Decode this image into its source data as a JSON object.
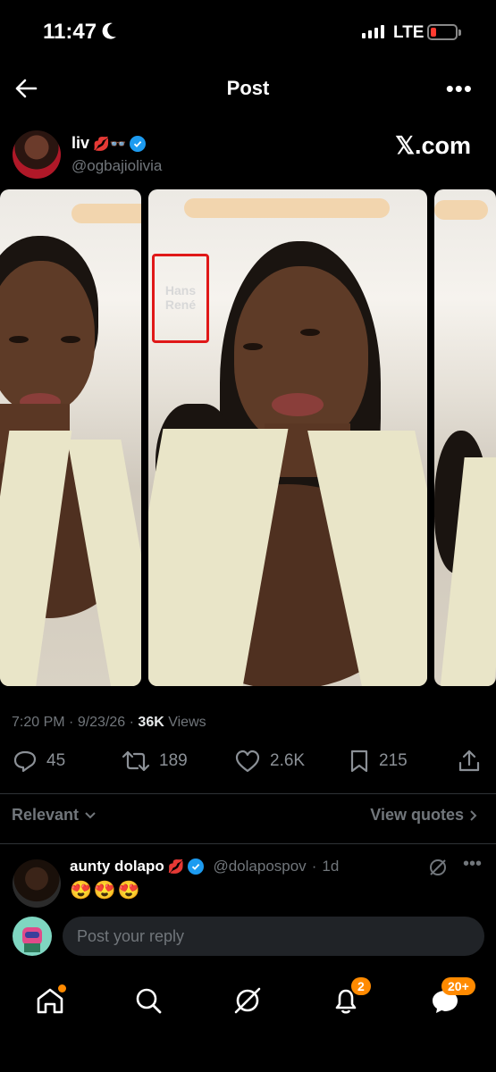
{
  "status_bar": {
    "time": "11:47",
    "network": "LTE"
  },
  "nav": {
    "title": "Post"
  },
  "author": {
    "name": "liv",
    "name_emoji": "💋👓",
    "handle": "@ogbajiolivia",
    "watermark": "𝕏.com"
  },
  "media": {
    "sign_text": "Hans René"
  },
  "post_meta": {
    "time": "7:20 PM",
    "date": "9/23/26",
    "views_count": "36K",
    "views_label": "Views"
  },
  "actions": {
    "replies": "45",
    "reposts": "189",
    "likes": "2.6K",
    "bookmarks": "215"
  },
  "filter": {
    "sort_label": "Relevant",
    "quotes_label": "View quotes"
  },
  "reply": {
    "name": "aunty dolapo",
    "name_emoji": "💋",
    "handle": "@dolapospov",
    "time": "1d",
    "text": "😍😍😍"
  },
  "compose": {
    "placeholder": "Post your reply"
  },
  "tabbar": {
    "notifications_badge": "2",
    "messages_badge": "20+"
  },
  "colors": {
    "accent": "#1d9bf0",
    "badge": "#ff8a00",
    "muted": "#71767b"
  }
}
